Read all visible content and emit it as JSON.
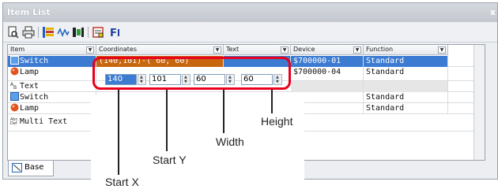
{
  "window": {
    "title": "Item List",
    "close_glyph": "x"
  },
  "toolbar": {
    "icons": [
      "print-preview-icon",
      "print-icon",
      "column-list-icon",
      "waveform-icon",
      "grid-color-icon",
      "settings-icon",
      "font-icon"
    ]
  },
  "grid": {
    "columns": [
      "Item",
      "Coordinates",
      "Text",
      "Device",
      "Function"
    ],
    "rows": [
      {
        "item": "Switch",
        "icon": "switch-icon",
        "coordinates": "(140,101)-( 60, 60)",
        "text": "",
        "device": "$700000-01",
        "function": "Standard",
        "selected": true
      },
      {
        "item": "Lamp",
        "icon": "lamp-icon",
        "coordinates": "",
        "text": "",
        "device": "$700000-04",
        "function": "Standard",
        "selected": false
      },
      {
        "item": "Text",
        "icon": "text-icon",
        "coordinates": "",
        "text": "",
        "device": "",
        "function": "",
        "selected": false
      },
      {
        "item": "Switch",
        "icon": "switch-icon",
        "coordinates": "",
        "text": "",
        "device": "",
        "function": "Standard",
        "selected": false
      },
      {
        "item": "Lamp",
        "icon": "lamp-icon",
        "coordinates": "",
        "text": "",
        "device": "",
        "function": "Standard",
        "selected": false
      },
      {
        "item": "Multi Text",
        "icon": "multi-text-icon",
        "coordinates": "",
        "text": "",
        "device": "",
        "function": "",
        "selected": false
      }
    ],
    "editor": {
      "start_x": "140",
      "start_y": "101",
      "width": "60",
      "height": "60"
    }
  },
  "tabs": {
    "base": "Base"
  },
  "annotations": {
    "start_x": "Start X",
    "start_y": "Start Y",
    "width": "Width",
    "height": "Height"
  },
  "colors": {
    "selection": "#3b7bd1",
    "coord_highlight": "#c8660e",
    "callout": "#e8001c"
  }
}
